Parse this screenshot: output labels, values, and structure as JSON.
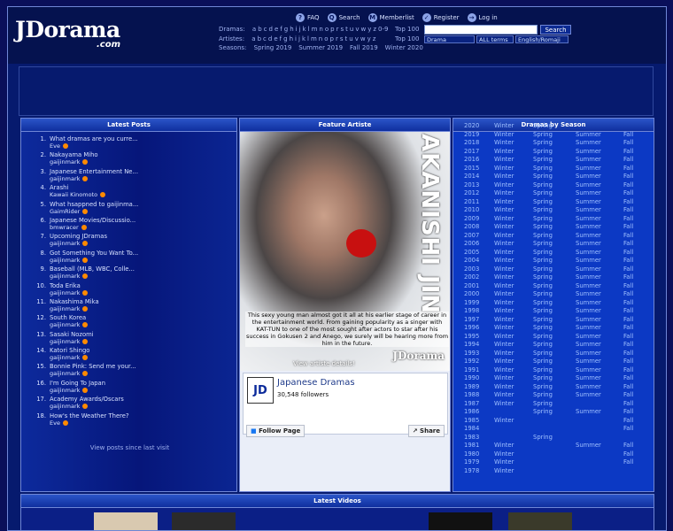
{
  "logo": {
    "main": "JDorama",
    "suffix": ".com"
  },
  "topnav": [
    {
      "icon": "faq-icon",
      "glyph": "?",
      "label": "FAQ"
    },
    {
      "icon": "search-icon",
      "glyph": "Q",
      "label": "Search"
    },
    {
      "icon": "memberlist-icon",
      "glyph": "M",
      "label": "Memberlist"
    },
    {
      "icon": "register-icon",
      "glyph": "✓",
      "label": "Register"
    },
    {
      "icon": "login-icon",
      "glyph": "→",
      "label": "Log in"
    }
  ],
  "dramas_row": {
    "label": "Dramas:",
    "letters": [
      "a",
      "b",
      "c",
      "d",
      "e",
      "f",
      "g",
      "h",
      "i",
      "j",
      "k",
      "l",
      "m",
      "n",
      "o",
      "p",
      "r",
      "s",
      "t",
      "u",
      "v",
      "w",
      "y",
      "z",
      "0-9"
    ],
    "top": "Top 100"
  },
  "artistes_row": {
    "label": "Artistes:",
    "letters": [
      "a",
      "b",
      "c",
      "d",
      "e",
      "f",
      "g",
      "h",
      "i",
      "j",
      "k",
      "l",
      "m",
      "n",
      "o",
      "p",
      "r",
      "s",
      "t",
      "u",
      "v",
      "w",
      "y",
      "z"
    ],
    "top": "Top 100"
  },
  "seasons_row": {
    "label": "Seasons:",
    "items": [
      "Spring 2019",
      "Summer 2019",
      "Fall 2019",
      "Winter 2020"
    ]
  },
  "search": {
    "input_value": "",
    "button": "Search",
    "type_select": "Drama",
    "terms_select": "ALL terms",
    "lang_select": "English/Romaji"
  },
  "latest_posts": {
    "title": "Latest Posts",
    "items": [
      {
        "n": "1.",
        "title": "What dramas are you curre...",
        "user": "Eve"
      },
      {
        "n": "2.",
        "title": "Nakayama Miho",
        "user": "gaijinmark"
      },
      {
        "n": "3.",
        "title": "Japanese Entertainment Ne...",
        "user": "gaijinmark"
      },
      {
        "n": "4.",
        "title": "Arashi",
        "user": "Kawaii Kinomoto"
      },
      {
        "n": "5.",
        "title": "What hsappned to gaijinma...",
        "user": "GaimRider"
      },
      {
        "n": "6.",
        "title": "Japanese Movies/Discussio...",
        "user": "bmwracer"
      },
      {
        "n": "7.",
        "title": "Upcoming JDramas",
        "user": "gaijinmark"
      },
      {
        "n": "8.",
        "title": "Got Something You Want To...",
        "user": "gaijinmark"
      },
      {
        "n": "9.",
        "title": "Baseball (MLB, WBC, Colle...",
        "user": "gaijinmark"
      },
      {
        "n": "10.",
        "title": "Toda Erika",
        "user": "gaijinmark"
      },
      {
        "n": "11.",
        "title": "Nakashima Mika",
        "user": "gaijinmark"
      },
      {
        "n": "12.",
        "title": "South Korea",
        "user": "gaijinmark"
      },
      {
        "n": "13.",
        "title": "Sasaki Nozomi",
        "user": "gaijinmark"
      },
      {
        "n": "14.",
        "title": "Katori Shingo",
        "user": "gaijinmark"
      },
      {
        "n": "15.",
        "title": "Bonnie Pink: Send me your...",
        "user": "gaijinmark"
      },
      {
        "n": "16.",
        "title": "I'm Going To Japan",
        "user": "gaijinmark"
      },
      {
        "n": "17.",
        "title": "Academy Awards/Oscars",
        "user": "gaijinmark"
      },
      {
        "n": "18.",
        "title": "How's the Weather There?",
        "user": "Eve"
      }
    ],
    "view_link": "View posts since last visit"
  },
  "feature": {
    "title": "Feature Artiste",
    "name": "AKANISHI JIN",
    "caption": "This sexy young man almost got it all at his earlier stage of career in the entertainment world. From gaining popularity as a singer with KAT-TUN to one of the most sought after actors to star after his success in Gokusen 2 and Anego, we surely will be hearing more from him in the future.",
    "watermark": "JDorama",
    "details": "View artiste details!"
  },
  "facebook": {
    "logo": "JD",
    "page": "Japanese Dramas",
    "followers": "30,548 followers",
    "follow": "Follow Page",
    "share": "Share"
  },
  "dramas_by_season": {
    "title": "Dramas by Season",
    "rows": [
      {
        "y": "2020",
        "w": "Winter",
        "sp": "Spring",
        "su": "",
        "f": ""
      },
      {
        "y": "2019",
        "w": "Winter",
        "sp": "Spring",
        "su": "Summer",
        "f": "Fall"
      },
      {
        "y": "2018",
        "w": "Winter",
        "sp": "Spring",
        "su": "Summer",
        "f": "Fall"
      },
      {
        "y": "2017",
        "w": "Winter",
        "sp": "Spring",
        "su": "Summer",
        "f": "Fall"
      },
      {
        "y": "2016",
        "w": "Winter",
        "sp": "Spring",
        "su": "Summer",
        "f": "Fall"
      },
      {
        "y": "2015",
        "w": "Winter",
        "sp": "Spring",
        "su": "Summer",
        "f": "Fall"
      },
      {
        "y": "2014",
        "w": "Winter",
        "sp": "Spring",
        "su": "Summer",
        "f": "Fall"
      },
      {
        "y": "2013",
        "w": "Winter",
        "sp": "Spring",
        "su": "Summer",
        "f": "Fall"
      },
      {
        "y": "2012",
        "w": "Winter",
        "sp": "Spring",
        "su": "Summer",
        "f": "Fall"
      },
      {
        "y": "2011",
        "w": "Winter",
        "sp": "Spring",
        "su": "Summer",
        "f": "Fall"
      },
      {
        "y": "2010",
        "w": "Winter",
        "sp": "Spring",
        "su": "Summer",
        "f": "Fall"
      },
      {
        "y": "2009",
        "w": "Winter",
        "sp": "Spring",
        "su": "Summer",
        "f": "Fall"
      },
      {
        "y": "2008",
        "w": "Winter",
        "sp": "Spring",
        "su": "Summer",
        "f": "Fall"
      },
      {
        "y": "2007",
        "w": "Winter",
        "sp": "Spring",
        "su": "Summer",
        "f": "Fall"
      },
      {
        "y": "2006",
        "w": "Winter",
        "sp": "Spring",
        "su": "Summer",
        "f": "Fall"
      },
      {
        "y": "2005",
        "w": "Winter",
        "sp": "Spring",
        "su": "Summer",
        "f": "Fall"
      },
      {
        "y": "2004",
        "w": "Winter",
        "sp": "Spring",
        "su": "Summer",
        "f": "Fall"
      },
      {
        "y": "2003",
        "w": "Winter",
        "sp": "Spring",
        "su": "Summer",
        "f": "Fall"
      },
      {
        "y": "2002",
        "w": "Winter",
        "sp": "Spring",
        "su": "Summer",
        "f": "Fall"
      },
      {
        "y": "2001",
        "w": "Winter",
        "sp": "Spring",
        "su": "Summer",
        "f": "Fall"
      },
      {
        "y": "2000",
        "w": "Winter",
        "sp": "Spring",
        "su": "Summer",
        "f": "Fall"
      },
      {
        "y": "1999",
        "w": "Winter",
        "sp": "Spring",
        "su": "Summer",
        "f": "Fall"
      },
      {
        "y": "1998",
        "w": "Winter",
        "sp": "Spring",
        "su": "Summer",
        "f": "Fall"
      },
      {
        "y": "1997",
        "w": "Winter",
        "sp": "Spring",
        "su": "Summer",
        "f": "Fall"
      },
      {
        "y": "1996",
        "w": "Winter",
        "sp": "Spring",
        "su": "Summer",
        "f": "Fall"
      },
      {
        "y": "1995",
        "w": "Winter",
        "sp": "Spring",
        "su": "Summer",
        "f": "Fall"
      },
      {
        "y": "1994",
        "w": "Winter",
        "sp": "Spring",
        "su": "Summer",
        "f": "Fall"
      },
      {
        "y": "1993",
        "w": "Winter",
        "sp": "Spring",
        "su": "Summer",
        "f": "Fall"
      },
      {
        "y": "1992",
        "w": "Winter",
        "sp": "Spring",
        "su": "Summer",
        "f": "Fall"
      },
      {
        "y": "1991",
        "w": "Winter",
        "sp": "Spring",
        "su": "Summer",
        "f": "Fall"
      },
      {
        "y": "1990",
        "w": "Winter",
        "sp": "Spring",
        "su": "Summer",
        "f": "Fall"
      },
      {
        "y": "1989",
        "w": "Winter",
        "sp": "Spring",
        "su": "Summer",
        "f": "Fall"
      },
      {
        "y": "1988",
        "w": "Winter",
        "sp": "Spring",
        "su": "Summer",
        "f": "Fall"
      },
      {
        "y": "1987",
        "w": "Winter",
        "sp": "Spring",
        "su": "",
        "f": "Fall"
      },
      {
        "y": "1986",
        "w": "",
        "sp": "Spring",
        "su": "Summer",
        "f": "Fall"
      },
      {
        "y": "1985",
        "w": "Winter",
        "sp": "",
        "su": "",
        "f": "Fall"
      },
      {
        "y": "1984",
        "w": "",
        "sp": "",
        "su": "",
        "f": "Fall"
      },
      {
        "y": "1983",
        "w": "",
        "sp": "Spring",
        "su": "",
        "f": ""
      },
      {
        "y": "1981",
        "w": "Winter",
        "sp": "",
        "su": "Summer",
        "f": "Fall"
      },
      {
        "y": "1980",
        "w": "Winter",
        "sp": "",
        "su": "",
        "f": "Fall"
      },
      {
        "y": "1979",
        "w": "Winter",
        "sp": "",
        "su": "",
        "f": "Fall"
      },
      {
        "y": "1978",
        "w": "Winter",
        "sp": "",
        "su": "",
        "f": ""
      }
    ]
  },
  "latest_videos": {
    "title": "Latest Videos"
  }
}
